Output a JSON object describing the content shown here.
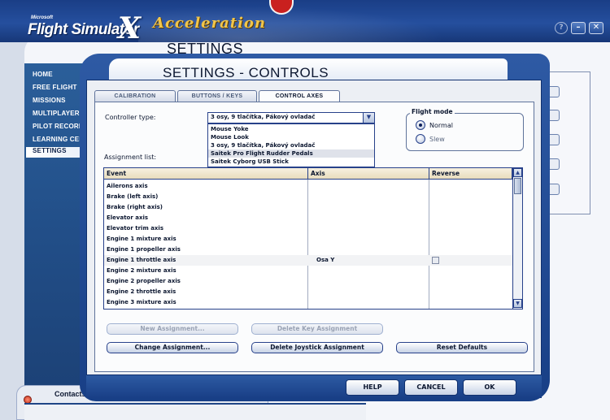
{
  "app": {
    "logo_microsoft": "Microsoft",
    "logo_flight_simulator": "Flight Simulator",
    "logo_x": "X",
    "logo_acceleration": "Acceleration",
    "heading": "SETTINGS",
    "window_buttons": {
      "help": "?",
      "minimize": "–",
      "close": "✕"
    }
  },
  "sidebar": {
    "items": [
      {
        "label": "HOME"
      },
      {
        "label": "FREE FLIGHT"
      },
      {
        "label": "MISSIONS"
      },
      {
        "label": "MULTIPLAYER"
      },
      {
        "label": "PILOT RECORDS"
      },
      {
        "label": "LEARNING CENTER"
      },
      {
        "label": "SETTINGS",
        "active": true
      }
    ],
    "contacts_label": "Contacts"
  },
  "dialog": {
    "title": "SETTINGS - CONTROLS",
    "tabs": [
      {
        "label": "CALIBRATION"
      },
      {
        "label": "BUTTONS / KEYS"
      },
      {
        "label": "CONTROL AXES",
        "active": true
      }
    ],
    "controller_type_label": "Controller type:",
    "controller_type_value": "3 osy, 9 tlačítka, Pákový ovladač",
    "dropdown_options": [
      "Mouse Yoke",
      "Mouse Look",
      "3 osy, 9 tlačítka, Pákový ovladač",
      "Saitek Pro Flight Rudder Pedals",
      "Saitek Cyborg USB Stick"
    ],
    "flight_mode": {
      "title": "Flight mode",
      "options": [
        {
          "label": "Normal",
          "selected": true
        },
        {
          "label": "Slew",
          "selected": false
        }
      ]
    },
    "assignment_list_label": "Assignment list:",
    "table": {
      "headers": [
        "Event",
        "Axis",
        "Reverse"
      ],
      "rows": [
        {
          "event": "Ailerons axis",
          "axis": ""
        },
        {
          "event": "Brake (left axis)",
          "axis": ""
        },
        {
          "event": "Brake (right axis)",
          "axis": ""
        },
        {
          "event": "Elevator axis",
          "axis": ""
        },
        {
          "event": "Elevator trim axis",
          "axis": ""
        },
        {
          "event": "Engine 1 mixture axis",
          "axis": ""
        },
        {
          "event": "Engine 1 propeller axis",
          "axis": ""
        },
        {
          "event": "Engine 1 throttle axis",
          "axis": "Osa Y",
          "reverse_box": true
        },
        {
          "event": "Engine 2 mixture axis",
          "axis": ""
        },
        {
          "event": "Engine 2 propeller axis",
          "axis": ""
        },
        {
          "event": "Engine 2 throttle axis",
          "axis": ""
        },
        {
          "event": "Engine 3 mixture axis",
          "axis": ""
        }
      ]
    },
    "buttons": {
      "new_assignment": "New Assignment...",
      "delete_key_assignment": "Delete Key Assignment",
      "change_assignment": "Change Assignment...",
      "delete_joystick_assignment": "Delete Joystick Assignment",
      "reset_defaults": "Reset Defaults",
      "help": "HELP",
      "cancel": "CANCEL",
      "ok": "OK"
    }
  },
  "colors": {
    "frame_blue": "#1e4a95",
    "panel_bg": "#fbfcfd",
    "accent_gold": "#f2c64a",
    "header_tan": "#e8dcbc"
  }
}
